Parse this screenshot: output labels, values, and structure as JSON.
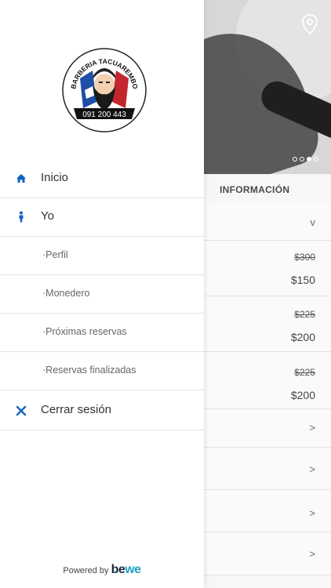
{
  "background": {
    "section_title": "INFORMACIÓN",
    "dots_count": 4,
    "dots_active_index": 2,
    "expand_chevron": "v",
    "services": [
      {
        "old_price": "$300",
        "new_price": "$150"
      },
      {
        "old_price": "$225",
        "new_price": "$200"
      },
      {
        "old_price": "$225",
        "new_price": "$200"
      }
    ],
    "more_rows": [
      ">",
      ">",
      ">",
      ">"
    ]
  },
  "drawer": {
    "logo": {
      "name": "BARBERIA TACUAREMBO",
      "phone": "091 200 443"
    },
    "menu": [
      {
        "label": "Inicio",
        "icon": "home-icon"
      },
      {
        "label": "Yo",
        "icon": "person-icon"
      },
      {
        "label": "·Perfil"
      },
      {
        "label": "·Monedero"
      },
      {
        "label": "·Próximas reservas"
      },
      {
        "label": "·Reservas finalizadas"
      },
      {
        "label": "Cerrar sesión",
        "icon": "close-icon"
      }
    ],
    "footer": {
      "powered_text": "Powered by",
      "brand_be": "be",
      "brand_we": "we"
    }
  },
  "colors": {
    "accent": "#1565c0",
    "brand_blue": "#1fa3c4"
  }
}
